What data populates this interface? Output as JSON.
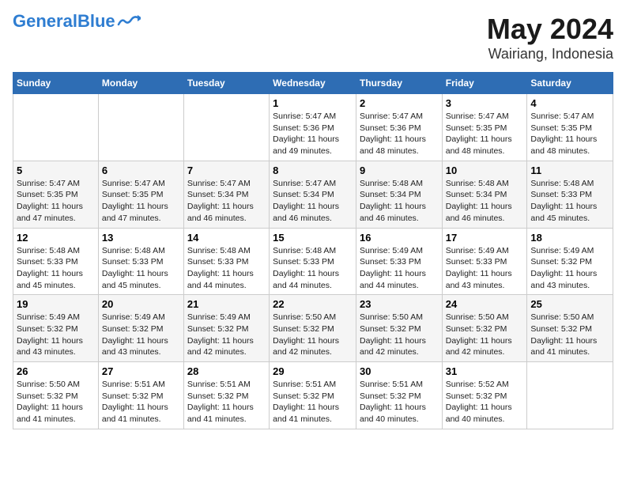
{
  "logo": {
    "part1": "General",
    "part2": "Blue"
  },
  "title": "May 2024",
  "subtitle": "Wairiang, Indonesia",
  "days_of_week": [
    "Sunday",
    "Monday",
    "Tuesday",
    "Wednesday",
    "Thursday",
    "Friday",
    "Saturday"
  ],
  "weeks": [
    [
      {
        "day": "",
        "content": ""
      },
      {
        "day": "",
        "content": ""
      },
      {
        "day": "",
        "content": ""
      },
      {
        "day": "1",
        "content": "Sunrise: 5:47 AM\nSunset: 5:36 PM\nDaylight: 11 hours and 49 minutes."
      },
      {
        "day": "2",
        "content": "Sunrise: 5:47 AM\nSunset: 5:36 PM\nDaylight: 11 hours and 48 minutes."
      },
      {
        "day": "3",
        "content": "Sunrise: 5:47 AM\nSunset: 5:35 PM\nDaylight: 11 hours and 48 minutes."
      },
      {
        "day": "4",
        "content": "Sunrise: 5:47 AM\nSunset: 5:35 PM\nDaylight: 11 hours and 48 minutes."
      }
    ],
    [
      {
        "day": "5",
        "content": "Sunrise: 5:47 AM\nSunset: 5:35 PM\nDaylight: 11 hours and 47 minutes."
      },
      {
        "day": "6",
        "content": "Sunrise: 5:47 AM\nSunset: 5:35 PM\nDaylight: 11 hours and 47 minutes."
      },
      {
        "day": "7",
        "content": "Sunrise: 5:47 AM\nSunset: 5:34 PM\nDaylight: 11 hours and 46 minutes."
      },
      {
        "day": "8",
        "content": "Sunrise: 5:47 AM\nSunset: 5:34 PM\nDaylight: 11 hours and 46 minutes."
      },
      {
        "day": "9",
        "content": "Sunrise: 5:48 AM\nSunset: 5:34 PM\nDaylight: 11 hours and 46 minutes."
      },
      {
        "day": "10",
        "content": "Sunrise: 5:48 AM\nSunset: 5:34 PM\nDaylight: 11 hours and 46 minutes."
      },
      {
        "day": "11",
        "content": "Sunrise: 5:48 AM\nSunset: 5:33 PM\nDaylight: 11 hours and 45 minutes."
      }
    ],
    [
      {
        "day": "12",
        "content": "Sunrise: 5:48 AM\nSunset: 5:33 PM\nDaylight: 11 hours and 45 minutes."
      },
      {
        "day": "13",
        "content": "Sunrise: 5:48 AM\nSunset: 5:33 PM\nDaylight: 11 hours and 45 minutes."
      },
      {
        "day": "14",
        "content": "Sunrise: 5:48 AM\nSunset: 5:33 PM\nDaylight: 11 hours and 44 minutes."
      },
      {
        "day": "15",
        "content": "Sunrise: 5:48 AM\nSunset: 5:33 PM\nDaylight: 11 hours and 44 minutes."
      },
      {
        "day": "16",
        "content": "Sunrise: 5:49 AM\nSunset: 5:33 PM\nDaylight: 11 hours and 44 minutes."
      },
      {
        "day": "17",
        "content": "Sunrise: 5:49 AM\nSunset: 5:33 PM\nDaylight: 11 hours and 43 minutes."
      },
      {
        "day": "18",
        "content": "Sunrise: 5:49 AM\nSunset: 5:32 PM\nDaylight: 11 hours and 43 minutes."
      }
    ],
    [
      {
        "day": "19",
        "content": "Sunrise: 5:49 AM\nSunset: 5:32 PM\nDaylight: 11 hours and 43 minutes."
      },
      {
        "day": "20",
        "content": "Sunrise: 5:49 AM\nSunset: 5:32 PM\nDaylight: 11 hours and 43 minutes."
      },
      {
        "day": "21",
        "content": "Sunrise: 5:49 AM\nSunset: 5:32 PM\nDaylight: 11 hours and 42 minutes."
      },
      {
        "day": "22",
        "content": "Sunrise: 5:50 AM\nSunset: 5:32 PM\nDaylight: 11 hours and 42 minutes."
      },
      {
        "day": "23",
        "content": "Sunrise: 5:50 AM\nSunset: 5:32 PM\nDaylight: 11 hours and 42 minutes."
      },
      {
        "day": "24",
        "content": "Sunrise: 5:50 AM\nSunset: 5:32 PM\nDaylight: 11 hours and 42 minutes."
      },
      {
        "day": "25",
        "content": "Sunrise: 5:50 AM\nSunset: 5:32 PM\nDaylight: 11 hours and 41 minutes."
      }
    ],
    [
      {
        "day": "26",
        "content": "Sunrise: 5:50 AM\nSunset: 5:32 PM\nDaylight: 11 hours and 41 minutes."
      },
      {
        "day": "27",
        "content": "Sunrise: 5:51 AM\nSunset: 5:32 PM\nDaylight: 11 hours and 41 minutes."
      },
      {
        "day": "28",
        "content": "Sunrise: 5:51 AM\nSunset: 5:32 PM\nDaylight: 11 hours and 41 minutes."
      },
      {
        "day": "29",
        "content": "Sunrise: 5:51 AM\nSunset: 5:32 PM\nDaylight: 11 hours and 41 minutes."
      },
      {
        "day": "30",
        "content": "Sunrise: 5:51 AM\nSunset: 5:32 PM\nDaylight: 11 hours and 40 minutes."
      },
      {
        "day": "31",
        "content": "Sunrise: 5:52 AM\nSunset: 5:32 PM\nDaylight: 11 hours and 40 minutes."
      },
      {
        "day": "",
        "content": ""
      }
    ]
  ]
}
